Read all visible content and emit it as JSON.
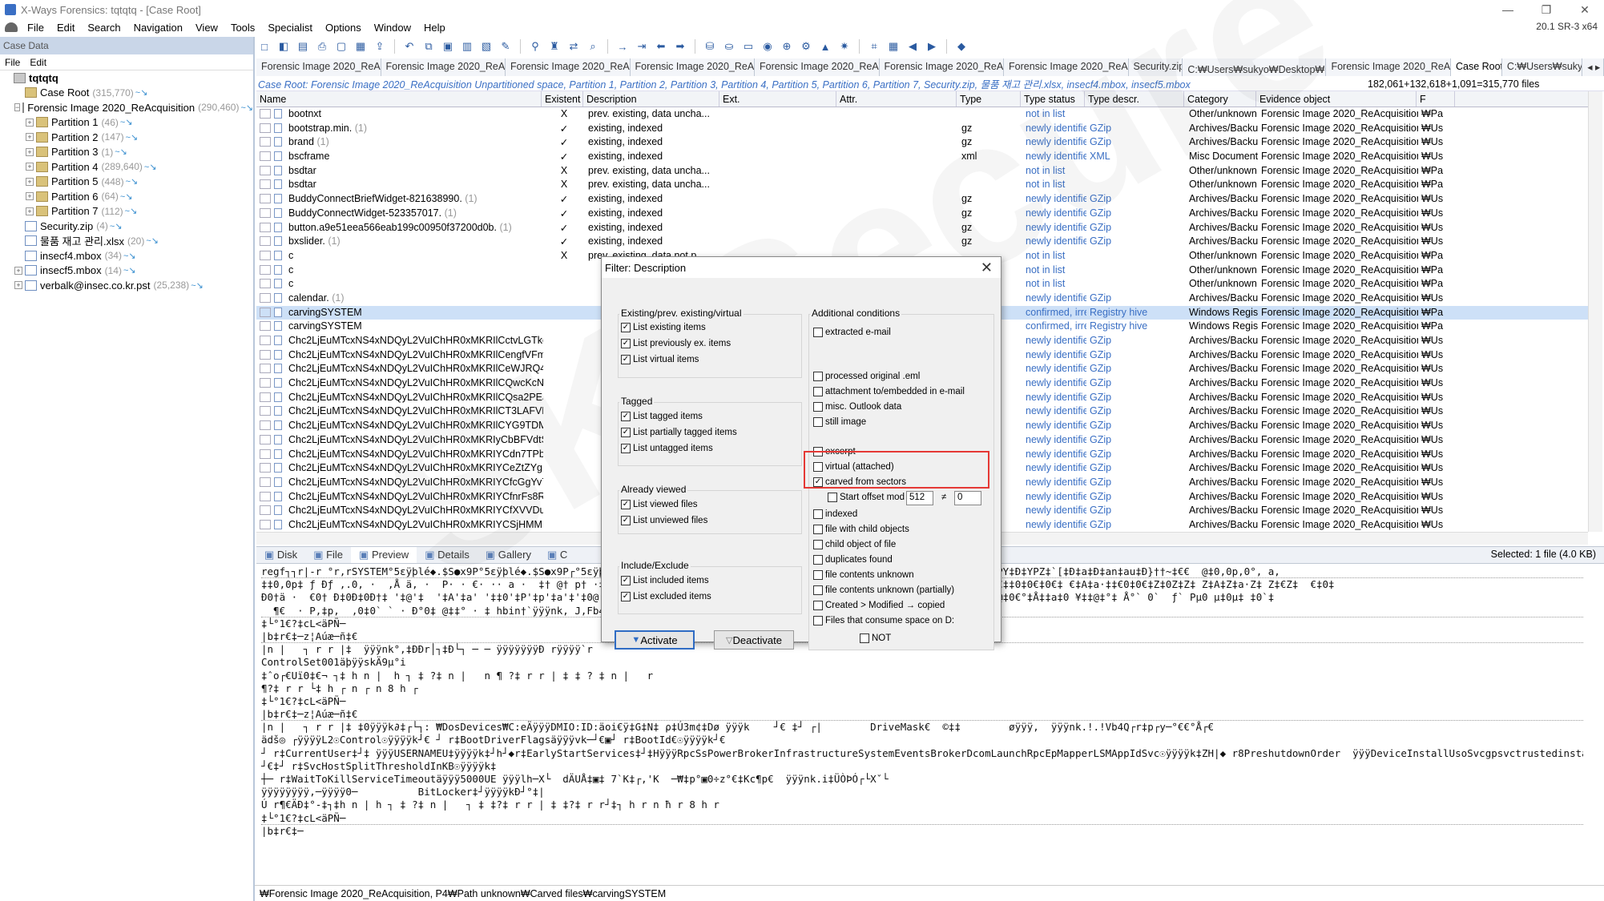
{
  "window": {
    "title": "X-Ways Forensics: tqtqtq - [Case Root]",
    "version": "20.1 SR-3 x64",
    "controls": [
      "—",
      "❐",
      "✕"
    ]
  },
  "menu": [
    "File",
    "Edit",
    "Search",
    "Navigation",
    "View",
    "Tools",
    "Specialist",
    "Options",
    "Window",
    "Help"
  ],
  "left_panel": {
    "header": "Case Data",
    "menu": [
      "File",
      "Edit"
    ],
    "tree": [
      {
        "label": "tqtqtq",
        "count": "",
        "level": 0,
        "exp": "",
        "icon": "drive"
      },
      {
        "label": "Case Root",
        "count": "(315,770)",
        "level": 1,
        "exp": "",
        "icon": "folder"
      },
      {
        "label": "Forensic Image 2020_ReAcquisition",
        "count": "(290,460)",
        "level": 1,
        "exp": "−",
        "icon": "drive"
      },
      {
        "label": "Partition 1",
        "count": "(46)",
        "level": 2,
        "exp": "+",
        "icon": "folder"
      },
      {
        "label": "Partition 2",
        "count": "(147)",
        "level": 2,
        "exp": "+",
        "icon": "folder"
      },
      {
        "label": "Partition 3",
        "count": "(1)",
        "level": 2,
        "exp": "+",
        "icon": "folder"
      },
      {
        "label": "Partition 4",
        "count": "(289,640)",
        "level": 2,
        "exp": "+",
        "icon": "folder"
      },
      {
        "label": "Partition 5",
        "count": "(448)",
        "level": 2,
        "exp": "+",
        "icon": "folder"
      },
      {
        "label": "Partition 6",
        "count": "(64)",
        "level": 2,
        "exp": "+",
        "icon": "folder"
      },
      {
        "label": "Partition 7",
        "count": "(112)",
        "level": 2,
        "exp": "+",
        "icon": "folder"
      },
      {
        "label": "Security.zip",
        "count": "(4)",
        "level": 1,
        "exp": "",
        "icon": "doc"
      },
      {
        "label": "물품 재고 관리.xlsx",
        "count": "(20)",
        "level": 1,
        "exp": "",
        "icon": "doc"
      },
      {
        "label": "insecf4.mbox",
        "count": "(34)",
        "level": 1,
        "exp": "",
        "icon": "doc"
      },
      {
        "label": "insecf5.mbox",
        "count": "(14)",
        "level": 1,
        "exp": "+",
        "icon": "doc"
      },
      {
        "label": "verbalk@insec.co.kr.pst",
        "count": "(25,238)",
        "level": 1,
        "exp": "+",
        "icon": "doc"
      }
    ]
  },
  "toolbar_icons": [
    "new-case-icon",
    "open-case-icon",
    "save-icon",
    "print-icon",
    "blank-icon",
    "properties-icon",
    "export-icon",
    "sep",
    "undo-icon",
    "copy-icon",
    "paste-icon",
    "clipboard-icon",
    "fill-icon",
    "edit-icon",
    "sep",
    "binoculars-icon",
    "search-hits-icon",
    "replace-icon",
    "hex-search-icon",
    "sep",
    "goto-icon",
    "goto-offset-icon",
    "back-icon",
    "forward-icon",
    "sep",
    "open-disk-icon",
    "open-image-icon",
    "hdd-icon",
    "snapshot-icon",
    "zoom-icon",
    "refine-icon",
    "chart-icon",
    "process-icon",
    "sep",
    "calc-icon",
    "grid-icon",
    "prev-icon",
    "next-icon",
    "sep",
    "help-icon"
  ],
  "tabs": [
    "Forensic Image 2020_ReAc...",
    "Forensic Image 2020_ReAc...",
    "Forensic Image 2020_ReAc...",
    "Forensic Image 2020_ReAc...",
    "Forensic Image 2020_ReAc...",
    "Forensic Image 2020_ReAc...",
    "Forensic Image 2020_ReAc...",
    "Security.zip",
    "C:₩Users₩sukyo₩Desktop₩물...",
    "Forensic Image 2020_ReAc...",
    "Case Root",
    "C:₩Users₩sukyo"
  ],
  "active_tab": 10,
  "path": "Case Root: Forensic Image 2020_ReAcquisition Unpartitioned space, Partition 1, Partition 2, Partition 3, Partition 4, Partition 5, Partition 6, Partition 7, Security.zip, 물품 재고 관리.xlsx, insecf4.mbox, insecf5.mbox",
  "file_count": "182,061+132,618+1,091=315,770 files",
  "columns": [
    "Name",
    "Existent",
    "Description",
    "Ext.",
    "Attr.",
    "Type",
    "Type status",
    "Type descr.",
    "Category",
    "Evidence object",
    "F"
  ],
  "rows": [
    [
      "bootnxt",
      "",
      "X",
      "prev. existing, data uncha...",
      "",
      "",
      "",
      "not in list",
      "",
      "Other/unknown t...",
      "Forensic Image 2020_ReAcquisition, P4",
      "₩Pa"
    ],
    [
      "bootstrap.min.",
      "(1)",
      "✓",
      "existing, indexed",
      "",
      "",
      "gz",
      "newly identified",
      "GZip",
      "Archives/Backup",
      "Forensic Image 2020_ReAcquisition, P4",
      "₩Us"
    ],
    [
      "brand",
      "(1)",
      "✓",
      "existing, indexed",
      "",
      "",
      "gz",
      "newly identified",
      "GZip",
      "Archives/Backup",
      "Forensic Image 2020_ReAcquisition, P4",
      "₩Us"
    ],
    [
      "bscframe",
      "",
      "✓",
      "existing, indexed",
      "",
      "",
      "xml",
      "newly identified",
      "XML",
      "Misc Documents",
      "Forensic Image 2020_ReAcquisition, P4",
      "₩Us"
    ],
    [
      "bsdtar",
      "",
      "X",
      "prev. existing, data uncha...",
      "",
      "",
      "",
      "not in list",
      "",
      "Other/unknown t...",
      "Forensic Image 2020_ReAcquisition, P4",
      "₩Pa"
    ],
    [
      "bsdtar",
      "",
      "X",
      "prev. existing, data uncha...",
      "",
      "",
      "",
      "not in list",
      "",
      "Other/unknown t...",
      "Forensic Image 2020_ReAcquisition, P4",
      "₩Pa"
    ],
    [
      "BuddyConnectBriefWidget-821638990.",
      "(1)",
      "✓",
      "existing, indexed",
      "",
      "",
      "gz",
      "newly identified",
      "GZip",
      "Archives/Backup",
      "Forensic Image 2020_ReAcquisition, P4",
      "₩Us"
    ],
    [
      "BuddyConnectWidget-523357017.",
      "(1)",
      "✓",
      "existing, indexed",
      "",
      "",
      "gz",
      "newly identified",
      "GZip",
      "Archives/Backup",
      "Forensic Image 2020_ReAcquisition, P4",
      "₩Us"
    ],
    [
      "button.a9e51eea566eab199c00950f37200d0b.",
      "(1)",
      "✓",
      "existing, indexed",
      "",
      "",
      "gz",
      "newly identified",
      "GZip",
      "Archives/Backup",
      "Forensic Image 2020_ReAcquisition, P4",
      "₩Us"
    ],
    [
      "bxslider.",
      "(1)",
      "✓",
      "existing, indexed",
      "",
      "",
      "gz",
      "newly identified",
      "GZip",
      "Archives/Backup",
      "Forensic Image 2020_ReAcquisition, P4",
      "₩Us"
    ],
    [
      "c",
      "",
      "X",
      "prev. existing, data not p...",
      "",
      "",
      "",
      "not in list",
      "",
      "Other/unknown t...",
      "Forensic Image 2020_ReAcquisition, P4",
      "₩Pa"
    ],
    [
      "c",
      "",
      "",
      "",
      "",
      "",
      "",
      "not in list",
      "",
      "Other/unknown t...",
      "Forensic Image 2020_ReAcquisition, P4",
      "₩Pa"
    ],
    [
      "c",
      "",
      "",
      "",
      "",
      "",
      "",
      "not in list",
      "",
      "Other/unknown t...",
      "Forensic Image 2020_ReAcquisition, P4",
      "₩Pa"
    ],
    [
      "calendar.",
      "(1)",
      "",
      "",
      "",
      "",
      "gz",
      "newly identified",
      "GZip",
      "Archives/Backup",
      "Forensic Image 2020_ReAcquisition, P4",
      "₩Us"
    ],
    [
      "carvingSYSTEM",
      "",
      "",
      "",
      "",
      "",
      "registry",
      "confirmed, irreg...",
      "Registry hive",
      "Windows Registry",
      "Forensic Image 2020_ReAcquisition, P4",
      "₩Pa"
    ],
    [
      "carvingSYSTEM",
      "",
      "",
      "",
      "",
      "",
      "registry",
      "confirmed, irreg...",
      "Registry hive",
      "Windows Registry",
      "Forensic Image 2020_ReAcquisition, P4",
      "₩Pa"
    ],
    [
      "Chc2LjEuMTcxNS4xNDQyL2VuIChHR0xMKRIlCctvLGTkcglHEgsNPR9T...",
      "",
      "",
      "",
      "",
      "",
      "gz",
      "newly identified",
      "GZip",
      "Archives/Backup",
      "Forensic Image 2020_ReAcquisition, P4",
      "₩Us"
    ],
    [
      "Chc2LjEuMTcxNS4xNDQyL2VuIChHR0xMKRIlCengfVFmNVqPEgsNy...",
      "",
      "",
      "",
      "",
      "",
      "gz",
      "newly identified",
      "GZip",
      "Archives/Backup",
      "Forensic Image 2020_ReAcquisition, P4",
      "₩Us"
    ],
    [
      "Chc2LjEuMTcxNS4xNDQyL2VuIChHR0xMKRIlCeWJRQ496WacEgsN...",
      "",
      "",
      "",
      "",
      "",
      "gz",
      "newly identified",
      "GZip",
      "Archives/Backup",
      "Forensic Image 2020_ReAcquisition, P4",
      "₩Us"
    ],
    [
      "Chc2LjEuMTcxNS4xNDQyL2VuIChHR0xMKRIlCQwcKcNQwWWEgsNb...",
      "",
      "",
      "",
      "",
      "",
      "gz",
      "newly identified",
      "GZip",
      "Archives/Backup",
      "Forensic Image 2020_ReAcquisition, P4",
      "₩Us"
    ],
    [
      "Chc2LjEuMTcxNS4xNDQyL2VuIChHR0xMKRIlCQsa2PEJBRU6EgsNWj...",
      "",
      "",
      "",
      "",
      "",
      "gz",
      "newly identified",
      "GZip",
      "Archives/Backup",
      "Forensic Image 2020_ReAcquisition, P4",
      "₩Us"
    ],
    [
      "Chc2LjEuMTcxNS4xNDQyL2VuIChHR0xMKRIlCT3LAFVEPwCYEgsN...",
      "",
      "",
      "",
      "",
      "",
      "gz",
      "newly identified",
      "GZip",
      "Archives/Backup",
      "Forensic Image 2020_ReAcquisition, P4",
      "₩Us"
    ],
    [
      "Chc2LjEuMTcxNS4xNDQyL2VuIChHR0xMKRIlCYG9TDMviDpIEgsN...",
      "",
      "",
      "",
      "",
      "",
      "gz",
      "newly identified",
      "GZip",
      "Archives/Backup",
      "Forensic Image 2020_ReAcquisition, P4",
      "₩Us"
    ],
    [
      "Chc2LjEuMTcxNS4xNDQyL2VuIChHR0xMKRIyCbBFVdtSK7fwEgsN5...",
      "",
      "",
      "",
      "",
      "",
      "gz",
      "newly identified",
      "GZip",
      "Archives/Backup",
      "Forensic Image 2020_ReAcquisition, P4",
      "₩Us"
    ],
    [
      "Chc2LjEuMTcxNS4xNDQyL2VuIChHR0xMKRIYCdn7TPbv...",
      "",
      "",
      "",
      "",
      "",
      "gz",
      "newly identified",
      "GZip",
      "Archives/Backup",
      "Forensic Image 2020_ReAcquisition, P4",
      "₩Us"
    ],
    [
      "Chc2LjEuMTcxNS4xNDQyL2VuIChHR0xMKRIYCeZtZYgFaPAaEgsNg...",
      "",
      "",
      "",
      "",
      "",
      "gz",
      "newly identified",
      "GZip",
      "Archives/Backup",
      "Forensic Image 2020_ReAcquisition, P4",
      "₩Us"
    ],
    [
      "Chc2LjEuMTcxNS4xNDQyL2VuIChHR0xMKRIYCfcGgYv7wmuNEgsNSc...",
      "",
      "",
      "",
      "",
      "",
      "gz",
      "newly identified",
      "GZip",
      "Archives/Backup",
      "Forensic Image 2020_ReAcquisition, P4",
      "₩Us"
    ],
    [
      "Chc2LjEuMTcxNS4xNDQyL2VuIChHR0xMKRIYCfnrFs8RFRf9EgsNeiogi...",
      "",
      "",
      "",
      "",
      "",
      "gz",
      "newly identified",
      "GZip",
      "Archives/Backup",
      "Forensic Image 2020_ReAcquisition, P4",
      "₩Us"
    ],
    [
      "Chc2LjEuMTcxNS4xNDQyL2VuIChHR0xMKRIYCfXVVDuyAKTxEgsNaU...",
      "",
      "",
      "",
      "",
      "",
      "gz",
      "newly identified",
      "GZip",
      "Archives/Backup",
      "Forensic Image 2020_ReAcquisition, P4",
      "₩Us"
    ],
    [
      "Chc2LjEuMTcxNS4xNDQyL2VuIChHR0xMKRIYCSjHMMPKbVWaE...",
      "",
      "",
      "",
      "",
      "",
      "gz",
      "newly identified",
      "GZip",
      "Archives/Backup",
      "Forensic Image 2020_ReAcquisition, P4",
      "₩Us"
    ]
  ],
  "selected_row": 14,
  "view_tabs": [
    "Disk",
    "File",
    "Preview",
    "Details",
    "Gallery",
    "C"
  ],
  "active_view_tab": 2,
  "selected_info": "Selected: 1 file (4.0 KB)",
  "preview_lines": [
    "regf┐┐r|-r °r,rSYSTEM°5εÿþlé◆.$S●x9P°5εÿþlé◆.$S●x9P┌°5εÿþlé◆.$S●x9P┌°5εÿþlé◆.$S●x9P┌   ‡A#HM!`MON‡pN‡OO† OO R†`S‡€S†‡U‡pW‡PY‡Ð‡YPZ‡`[‡Ð‡a‡Ð‡an‡au‡Ð}††~‡€€  @‡0,0p,0°, a,",
    "‡‡0,0p‡ ƒ Ðƒ ,.0, ·  ,Å ä, ·  P· · €· ·· a ·  ‡† @† p† ·‡ †† @ · ä   ‡†0 0 0 ‡ 0 0 ‡ ‡ 0   €‡†  ·‡A·‡a·‡‡€0€‡ €‡€€‡ €‡A‡a·€‡‡0‡0€‡0€‡ €‡A‡a·‡‡€0‡0€‡Z‡0Z‡Z‡ Z‡A‡Z‡a·Z‡ Z‡€Z‡  €‡0‡",
    "Ð0†ä ·  €0† Ð‡0Ð‡0Ð†‡ '‡@'‡  '‡A'‡a' '‡‡0'‡P'‡p'‡a'‡'‡0@'‡A'‡'‡0'‡ €0' ·  ‡0ÝYÞPÝ‡0ÝYÞ‡0 ‡0ì ø0@ε pø0 εÅ ¥‡$†  °ρ `°0 ‡0@ @‡0€°‡Å‡‡a‡0 ¥‡‡@‡°‡ Å°` 0`  ƒ` Pµ0 µ‡0µ‡ ‡0`‡",
    "  ¶€  · P,‡p,  ,0‡0` ` · Ð°0‡ @‡‡° · ‡ hbin†`ÿÿÿnk, J,Fb4Q┌r‡‡'┌€'     ‡ΰ₽rr└┐†h r n ħ n 8 h r",
    "‡└°1€?‡cL<äPÑ─",
    "|b‡r€‡─z¦Aúæ─ñ‡€",
    "|n |   ┐ r r |‡  ÿÿÿnk°‚‡ÐÐr│┐‡Ð└┐ ─ ─ ÿÿÿÿÿÿÿÐ rÿÿÿÿ`r",
    "ControlSet001äþÿÿskÄ9µ°i",
    "‡ˆo┌€UïΘ‡€¬ ┐‡ h n |  h ┐ ‡ ?‡ n |   n ¶ ?‡ r r | ‡ ‡ ? ‡ n |   r",
    "¶?‡ r r └‡ h ┌ n ┌ n 8 h ┌",
    "‡└°1€?‡cL<äPÑ─",
    "|b‡r€‡─z¦Aúæ─ñ‡€",
    "|n |   ┐ r r |‡ ‡0ÿÿÿk∂‡┌└┐: ₩DosDevices₩C:eÄÿÿÿDMIO:ID:äoi€ÿ‡G‡N‡ ρ‡Ú3m¢‡Dø ÿÿÿk    ┘€ ‡┘ ┌|        DriveMask€  ©‡‡        øÿÿÿ,  ÿÿÿnk.!.!Vb4Q┌r‡p┌y─°€€°Å┌€",
    "ädš◎ ┌ÿÿÿÿL2☉Control☉ÿÿÿÿk┘€ ┘ r‡BootDriverFlagsäÿÿÿvk─┘€▣┘ r‡BootId€☉ÿÿÿÿk┘€",
    "┘ r‡CurrentUser‡┘‡ ÿÿÿUSERNAMEU‡ÿÿÿÿk‡┘h┘◆r‡EarlyStartServices‡┘‡HÿÿÿRpcSsPowerBrokerInfrastructureSystemEventsBrokerDcomLaunchRpcEpMapperLSMAppIdSvc☉ÿÿÿÿk‡ZH|◆ r8PreshutdownOrder  ÿÿÿDeviceInstallUsoSvcgpsvctrustedinstallerÉÿÿÿÿk‡",
    "┘€‡┘ r‡SvcHostSplitThresholdInKB☉ÿÿÿÿk‡",
    "┼─ r‡WaitToKillServiceTimeoutäÿÿÿ5000UE ÿÿÿlh─X└  dÄUÅ‡▣‡ 7`K‡┌‚'K  ─₩‡p°▣0÷z°€‡Kc¶p€  ÿÿÿnk.i‡ÜÒÞÓ┌└Xˇ└",
    "ÿÿÿÿÿÿÿÿ,─ÿÿÿÿ0─          BitLocker‡┘ÿÿÿÿkÐ┘°‡|",
    "Ú r¶€ÄÐ‡°-‡┐‡h n | h ┐ ‡ ?‡ n |   ┐ ‡ ‡?‡ r r | ‡ ‡?‡ r r┘‡┐ h r n ħ r 8 h r",
    "‡└°1€?‡cL<äPÑ─",
    "|b‡r€‡─"
  ],
  "preview_dotted_after": [
    0,
    3,
    5,
    11,
    19
  ],
  "status_path": "₩Forensic Image 2020_ReAcquisition, P4₩Path unknown₩Carved files₩carvingSYSTEM",
  "watermark": "SK Secure",
  "filter_dialog": {
    "title": "Filter: Description",
    "groups": {
      "existing": {
        "title": "Existing/prev. existing/virtual",
        "items": [
          {
            "label": "List existing items",
            "checked": true
          },
          {
            "label": "List previously ex. items",
            "checked": true
          },
          {
            "label": "List virtual items",
            "checked": true
          }
        ]
      },
      "tagged": {
        "title": "Tagged",
        "items": [
          {
            "label": "List tagged items",
            "checked": true
          },
          {
            "label": "List partially tagged items",
            "checked": true
          },
          {
            "label": "List untagged items",
            "checked": true
          }
        ]
      },
      "viewed": {
        "title": "Already viewed",
        "items": [
          {
            "label": "List viewed files",
            "checked": true
          },
          {
            "label": "List unviewed files",
            "checked": true
          }
        ]
      },
      "include": {
        "title": "Include/Exclude",
        "items": [
          {
            "label": "List included items",
            "checked": true
          },
          {
            "label": "List excluded items",
            "checked": true
          }
        ]
      },
      "additional": {
        "title": "Additional conditions",
        "items": [
          {
            "label": "extracted e-mail",
            "checked": false
          },
          {
            "label": "processed original .eml",
            "checked": false
          },
          {
            "label": "attachment to/embedded in e-mail",
            "checked": false
          },
          {
            "label": "misc. Outlook data",
            "checked": false
          },
          {
            "label": "still image",
            "checked": false
          },
          {
            "label": "excerpt",
            "checked": false
          },
          {
            "label": "virtual (attached)",
            "checked": false
          },
          {
            "label": "carved from sectors",
            "checked": true
          },
          {
            "label": "indexed",
            "checked": false
          },
          {
            "label": "file with child objects",
            "checked": false
          },
          {
            "label": "child object of file",
            "checked": false
          },
          {
            "label": "duplicates found",
            "checked": false
          },
          {
            "label": "file contents unknown",
            "checked": false
          },
          {
            "label": "file contents unknown (partially)",
            "checked": false
          },
          {
            "label": "Created > Modified → copied",
            "checked": false
          },
          {
            "label": "Files that consume space on D:",
            "checked": false
          }
        ]
      }
    },
    "start_offset": {
      "label": "Start offset mod",
      "checked": false,
      "mod": "512",
      "op": "≠",
      "value": "0"
    },
    "not_label": "NOT",
    "activate": "Activate",
    "deactivate": "Deactivate"
  }
}
